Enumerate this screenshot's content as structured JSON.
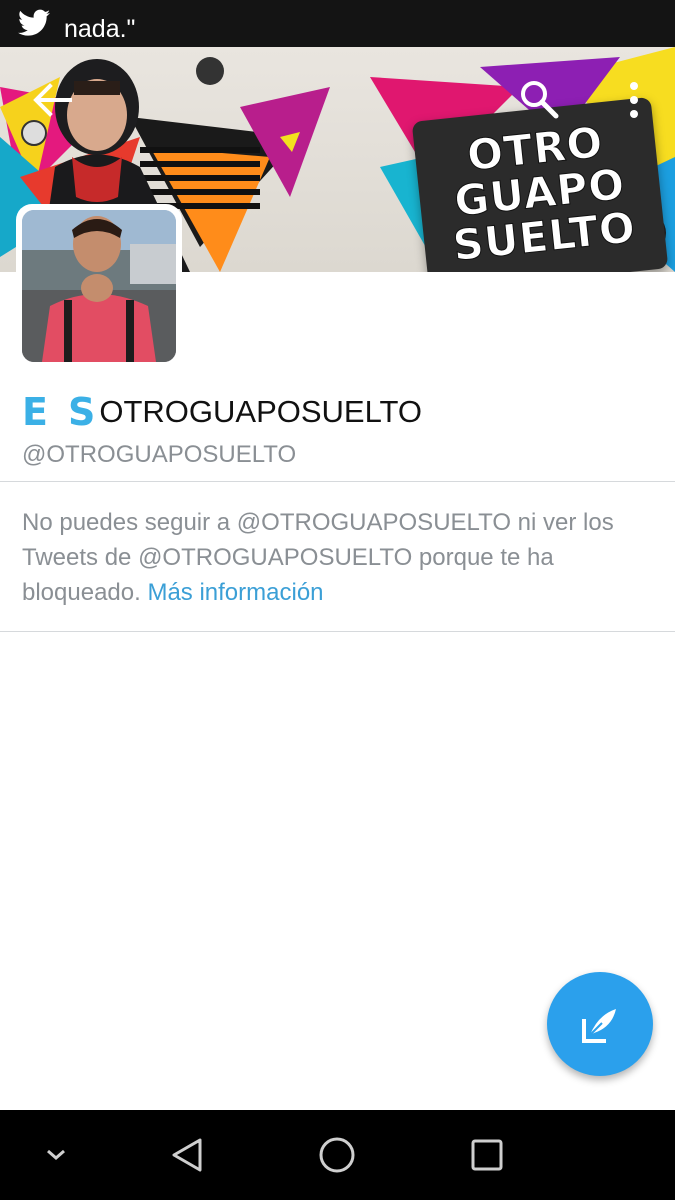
{
  "status_bar": {
    "notification_text": "nada.\"",
    "icon": "twitter-bird-icon"
  },
  "app_bar": {
    "back_icon": "arrow-left-icon",
    "search_icon": "search-icon",
    "more_icon": "more-vertical-icon"
  },
  "header": {
    "banner_lines": [
      "OTRO",
      "GUAPO",
      "SUELTO"
    ]
  },
  "profile": {
    "name_prefix_1": "E",
    "name_prefix_2": "S",
    "display_name": "OTROGUAPOSUELTO",
    "handle": "@OTROGUAPOSUELTO"
  },
  "blocked_notice": {
    "text": "No puedes seguir a @OTROGUAPOSUELTO ni ver los Tweets de @OTROGUAPOSUELTO porque te ha bloqueado.",
    "link_label": "Más información"
  },
  "fab": {
    "icon": "compose-tweet-icon"
  },
  "nav_bar": {
    "items": [
      "chevron-down-icon",
      "back-triangle-icon",
      "home-circle-icon",
      "recents-square-icon"
    ]
  },
  "colors": {
    "accent": "#2ba0ec",
    "link": "#3b9fd6",
    "name_prefix": "#3bb0e6",
    "muted_text": "#8a8f94"
  }
}
